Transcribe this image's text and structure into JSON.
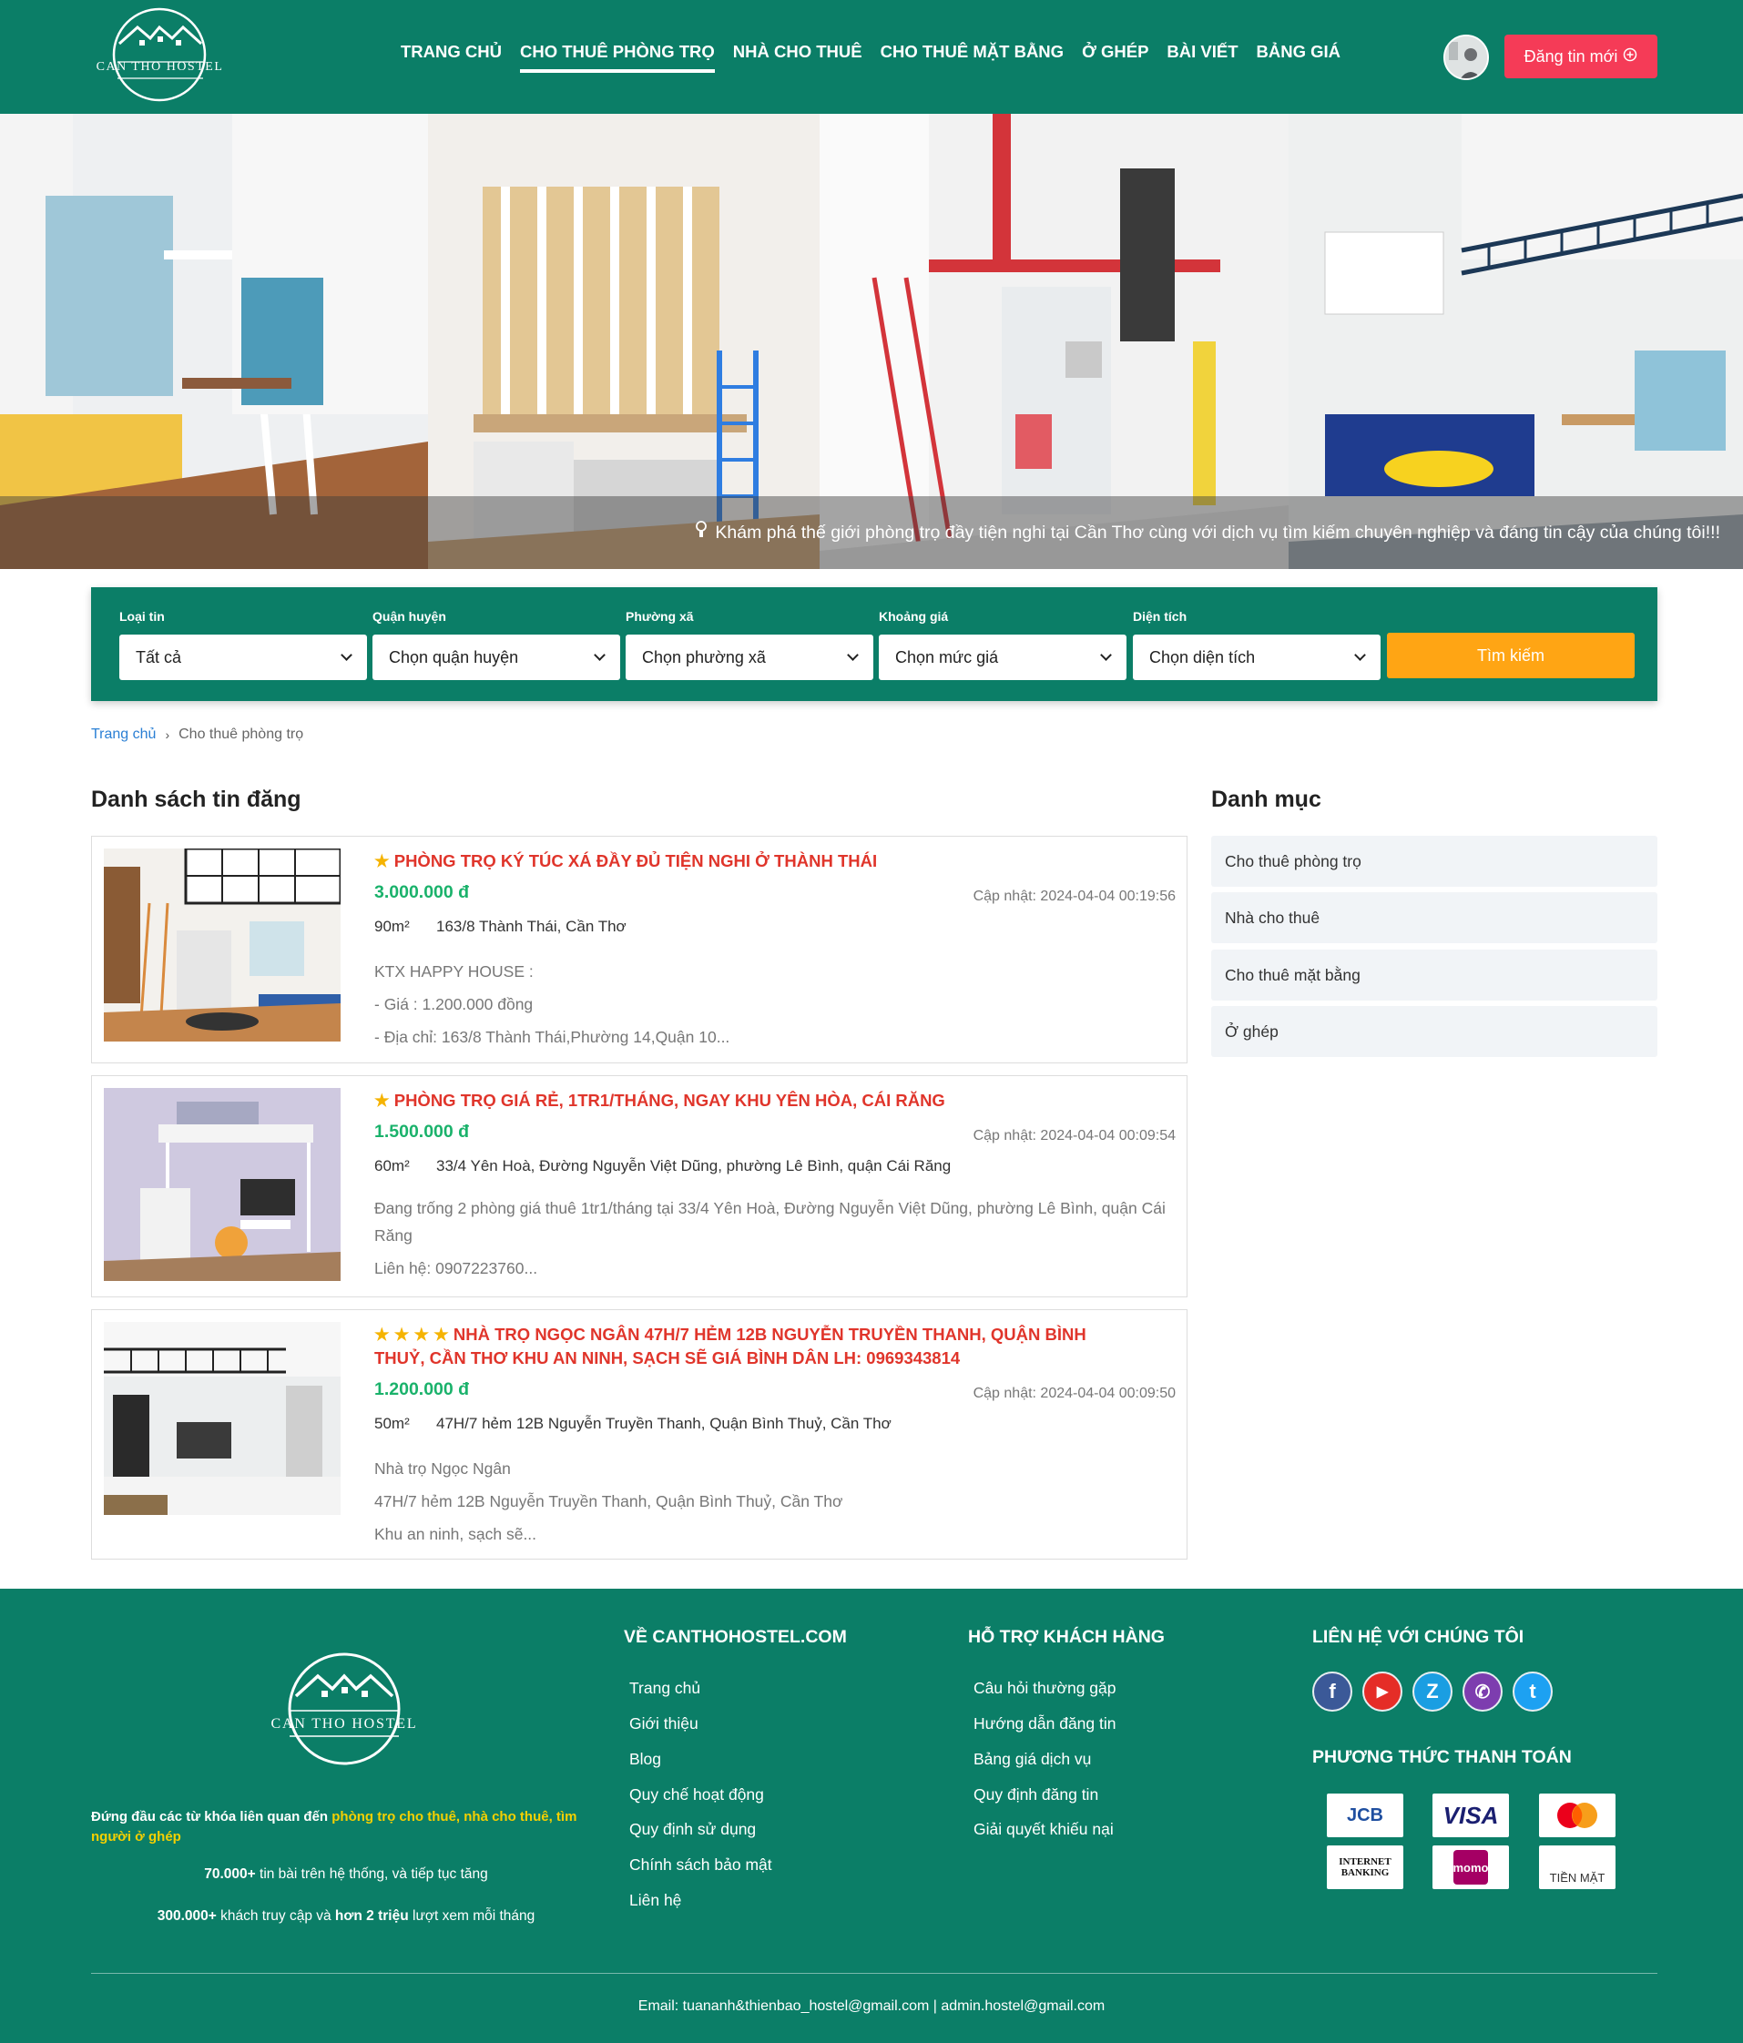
{
  "header": {
    "logo_text": "CAN THO HOSTEL",
    "nav": [
      {
        "label": "TRANG CHỦ",
        "active": false
      },
      {
        "label": "CHO THUÊ PHÒNG TRỌ",
        "active": true
      },
      {
        "label": "NHÀ CHO THUÊ",
        "active": false
      },
      {
        "label": "CHO THUÊ MẶT BẰNG",
        "active": false
      },
      {
        "label": "Ở GHÉP",
        "active": false
      },
      {
        "label": "BÀI VIẾT",
        "active": false
      },
      {
        "label": "BẢNG GIÁ",
        "active": false
      }
    ],
    "post_button": "Đăng tin mới",
    "accent_color": "#0b7e67",
    "button_color": "#f53b57"
  },
  "hero": {
    "caption": "Khám phá thế giới phòng trọ đầy tiện nghi tại Cần Thơ cùng với dịch vụ tìm kiếm chuyên nghiệp và đáng tin cậy của chúng tôi!!!"
  },
  "search": {
    "filters": [
      {
        "label": "Loại tin",
        "value": "Tất cả"
      },
      {
        "label": "Quận huyện",
        "value": "Chọn quận huyện"
      },
      {
        "label": "Phường xã",
        "value": "Chọn phường xã"
      },
      {
        "label": "Khoảng giá",
        "value": "Chọn mức giá"
      },
      {
        "label": "Diện tích",
        "value": "Chọn diện tích"
      }
    ],
    "button": "Tìm kiếm"
  },
  "breadcrumb": {
    "home": "Trang chủ",
    "current": "Cho thuê phòng trọ"
  },
  "listing_title": "Danh sách tin đăng",
  "listings": [
    {
      "stars": "★",
      "title": "PHÒNG TRỌ KÝ TÚC XÁ ĐẦY ĐỦ TIỆN NGHI Ở THÀNH THÁI",
      "price": "3.000.000 đ",
      "updated": "Cập nhật: 2024-04-04 00:19:56",
      "area": "90m²",
      "address": "163/8 Thành Thái, Cần Thơ",
      "desc": [
        "KTX HAPPY HOUSE :",
        "- Giá : 1.200.000 đồng",
        "- Địa chỉ: 163/8 Thành Thái,Phường 14,Quận 10..."
      ]
    },
    {
      "stars": "★",
      "title": "PHÒNG TRỌ GIÁ RẺ, 1TR1/THÁNG, NGAY KHU YÊN HÒA, CÁI RĂNG",
      "price": "1.500.000 đ",
      "updated": "Cập nhật: 2024-04-04 00:09:54",
      "area": "60m²",
      "address": "33/4 Yên Hoà, Đường Nguyễn Việt Dũng, phường Lê Bình, quận Cái Răng",
      "desc": [
        "Đang trống 2 phòng giá thuê 1tr1/tháng tại 33/4 Yên Hoà, Đường Nguyễn Việt Dũng, phường Lê Bình, quận Cái Răng",
        "Liên hệ: 0907223760..."
      ]
    },
    {
      "stars": "★ ★ ★ ★",
      "title": "NHÀ TRỌ NGỌC NGÂN 47H/7 HẺM 12B NGUYỄN TRUYỀN THANH, QUẬN BÌNH THUỶ, CẦN THƠ KHU AN NINH, SẠCH SẼ GIÁ BÌNH DÂN LH: 0969343814",
      "price": "1.200.000 đ",
      "updated": "Cập nhật: 2024-04-04 00:09:50",
      "area": "50m²",
      "address": "47H/7 hẻm 12B Nguyễn Truyền Thanh, Quận Bình Thuỷ, Cần Thơ",
      "desc": [
        "Nhà trọ Ngọc Ngân",
        "47H/7 hẻm 12B Nguyễn Truyền Thanh, Quận Bình Thuỷ, Cần Thơ",
        "Khu an ninh, sạch sẽ..."
      ]
    }
  ],
  "sidebar": {
    "title": "Danh mục",
    "items": [
      "Cho thuê phòng trọ",
      "Nhà cho thuê",
      "Cho thuê mặt bằng",
      "Ở ghép"
    ]
  },
  "footer": {
    "logo_text": "CAN THO HOSTEL",
    "tagline_prefix": "Đứng đầu các từ khóa liên quan đến ",
    "tagline_highlight": "phòng trọ cho thuê, nhà cho thuê, tìm người ở ghép",
    "stat1_bold": "70.000+",
    "stat1_rest": " tin bài trên hệ thống, và tiếp tục tăng",
    "stat2_bold1": "300.000+",
    "stat2_mid": " khách truy cập và ",
    "stat2_bold2": "hơn 2 triệu",
    "stat2_rest": " lượt xem mỗi tháng",
    "about_title": "VỀ CANTHOHOSTEL.COM",
    "about_links": [
      "Trang chủ",
      "Giới thiệu",
      "Blog",
      "Quy chế hoạt động",
      "Quy định sử dụng",
      "Chính sách bảo mật",
      "Liên hệ"
    ],
    "support_title": "HỖ TRỢ KHÁCH HÀNG",
    "support_links": [
      "Câu hỏi thường gặp",
      "Hướng dẫn đăng tin",
      "Bảng giá dịch vụ",
      "Quy định đăng tin",
      "Giải quyết khiếu nại"
    ],
    "contact_title": "LIÊN HỆ VỚI CHÚNG TÔI",
    "social": [
      {
        "icon": "facebook-icon",
        "glyph": "f",
        "color": "#3b5998"
      },
      {
        "icon": "youtube-icon",
        "glyph": "▶",
        "color": "#e52d27"
      },
      {
        "icon": "zalo-icon",
        "glyph": "Z",
        "color": "#1a9ee2"
      },
      {
        "icon": "viber-icon",
        "glyph": "✆",
        "color": "#7d3daf"
      },
      {
        "icon": "twitter-icon",
        "glyph": "t",
        "color": "#1da1f2"
      }
    ],
    "payment_title": "PHƯƠNG THỨC THANH TOÁN",
    "payments": [
      "JCB",
      "VISA",
      "mastercard",
      "INTERNET BANKING",
      "momo",
      "TIỀN MẶT"
    ],
    "contact_line": "Email: tuananh&thienbao_hostel@gmail.com | admin.hostel@gmail.com"
  }
}
